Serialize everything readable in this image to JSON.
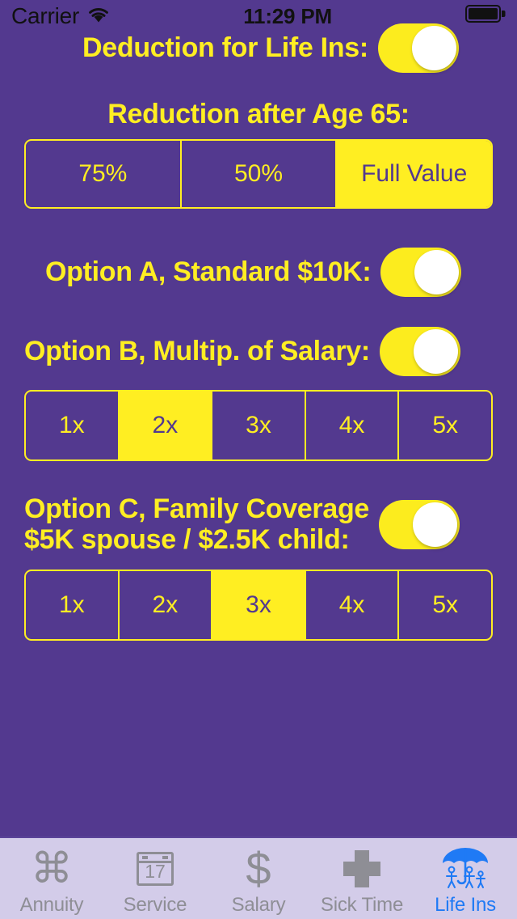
{
  "colors": {
    "background": "#53398F",
    "accent_yellow": "#FFEE22",
    "tabbar_background": "#D3CCE9",
    "tab_active": "#1F7AF5",
    "tab_inactive": "#8E8E95",
    "knob_white": "#FFFFFF"
  },
  "status_bar": {
    "carrier": "Carrier",
    "wifi_icon": "wifi-icon",
    "time": "11:29 PM",
    "battery_icon": "battery-full-icon"
  },
  "main": {
    "deduction": {
      "label": "Deduction for Life Ins:",
      "switch_state": "on"
    },
    "reduction": {
      "heading": "Reduction after Age 65:",
      "options": [
        "75%",
        "50%",
        "Full Value"
      ],
      "selected_index": 2,
      "selected_value": "Full Value"
    },
    "option_a": {
      "label": "Option A, Standard $10K:",
      "switch_state": "on"
    },
    "option_b": {
      "label": "Option B, Multip. of Salary:",
      "switch_state": "on",
      "multipliers": [
        "1x",
        "2x",
        "3x",
        "4x",
        "5x"
      ],
      "selected_index": 1,
      "selected_value": "2x"
    },
    "option_c": {
      "label": "Option C, Family Coverage\n$5K spouse / $2.5K child:",
      "switch_state": "on",
      "multipliers": [
        "1x",
        "2x",
        "3x",
        "4x",
        "5x"
      ],
      "selected_index": 2,
      "selected_value": "3x"
    }
  },
  "tabbar": {
    "items": [
      {
        "label": "Annuity",
        "icon": "command-loop-icon",
        "active": false
      },
      {
        "label": "Service",
        "icon": "calendar-17-icon",
        "active": false,
        "calendar_day": "17"
      },
      {
        "label": "Salary",
        "icon": "dollar-sign-icon",
        "active": false
      },
      {
        "label": "Sick Time",
        "icon": "plus-cross-icon",
        "active": false
      },
      {
        "label": "Life Ins",
        "icon": "umbrella-family-icon",
        "active": true
      }
    ],
    "active_index": 4
  }
}
